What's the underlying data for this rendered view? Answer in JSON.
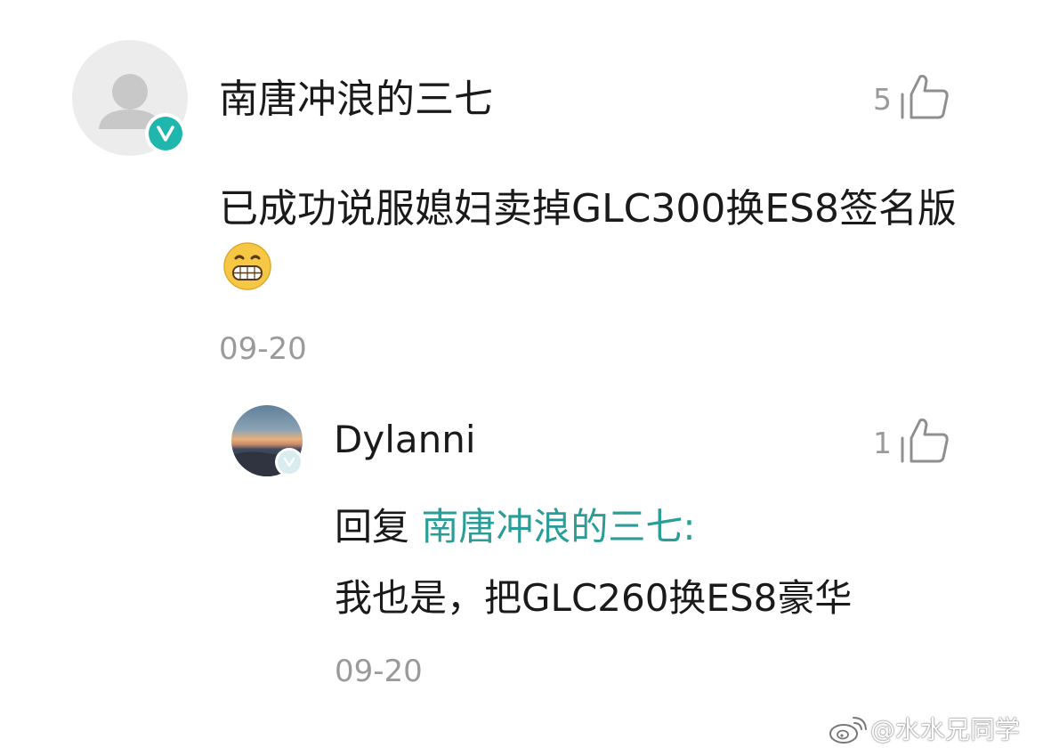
{
  "main_comment": {
    "username": "南唐冲浪的三七",
    "likes": "5",
    "text": "已成功说服媳妇卖掉GLC300换ES8签名版",
    "emoji": "grinning-face-emoji",
    "date": "09-20",
    "verified_badge_icon": "v-badge-icon"
  },
  "reply": {
    "username": "Dylanni",
    "likes": "1",
    "prefix": "回复",
    "mention": "南唐冲浪的三七:",
    "text": "我也是，把GLC260换ES8豪华",
    "date": "09-20"
  },
  "watermark": {
    "text": "@水水兄同学",
    "icon": "weibo-icon"
  },
  "colors": {
    "text": "#1a1a1a",
    "muted": "#9a9a9a",
    "mention": "#2a9d98",
    "badge": "#1fb7ad"
  }
}
